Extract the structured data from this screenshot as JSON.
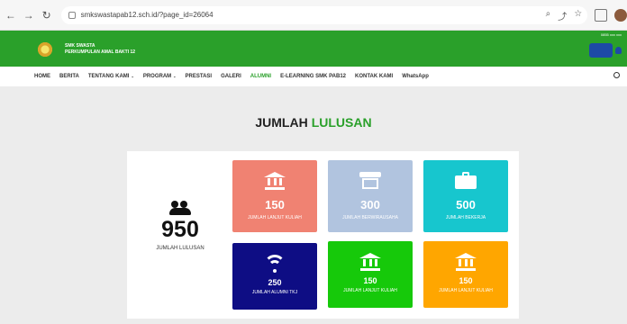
{
  "browser": {
    "url": "smkswastapab12.sch.id/?page_id=26064"
  },
  "header": {
    "school_line1": "SMK SWASTA",
    "school_line2": "PERKUMPULAN AMAL BAKTI 12",
    "top_right": "0855 xxx xxx"
  },
  "menu": [
    "HOME",
    "BERITA",
    "TENTANG KAMI",
    "PROGRAM",
    "PRESTASI",
    "GALERI",
    "ALUMNI",
    "E-LEARNING SMK PAB12",
    "KONTAK KAMI",
    "WhatsApp"
  ],
  "page": {
    "title_main": "JUMLAH",
    "title_accent": "LULUSAN"
  },
  "total": {
    "value": "950",
    "label": "JUMLAH LULUSAN"
  },
  "cards": [
    {
      "value": "150",
      "label": "JUMLAH LANJUT KULIAH",
      "color": "#f08272"
    },
    {
      "value": "300",
      "label": "JUMLAH BERWIRAUSAHA",
      "color": "#b1c4df"
    },
    {
      "value": "500",
      "label": "JUMLAH BEKERJA",
      "color": "#17c6ce"
    },
    {
      "value": "250",
      "label": "JUMLAH ALUMNI TKJ",
      "color": "#0e0d84"
    },
    {
      "value": "150",
      "label": "JUMLAH LANJUT KULIAH",
      "color": "#16c90a"
    },
    {
      "value": "150",
      "label": "JUMLAH LANJUT KULIAH",
      "color": "#ffa600"
    }
  ],
  "icons": [
    "back-icon",
    "forward-icon",
    "reload-icon",
    "lock-icon",
    "bank-icon",
    "store-icon",
    "briefcase-icon",
    "wifi-icon",
    "users-icon",
    "search-icon"
  ]
}
